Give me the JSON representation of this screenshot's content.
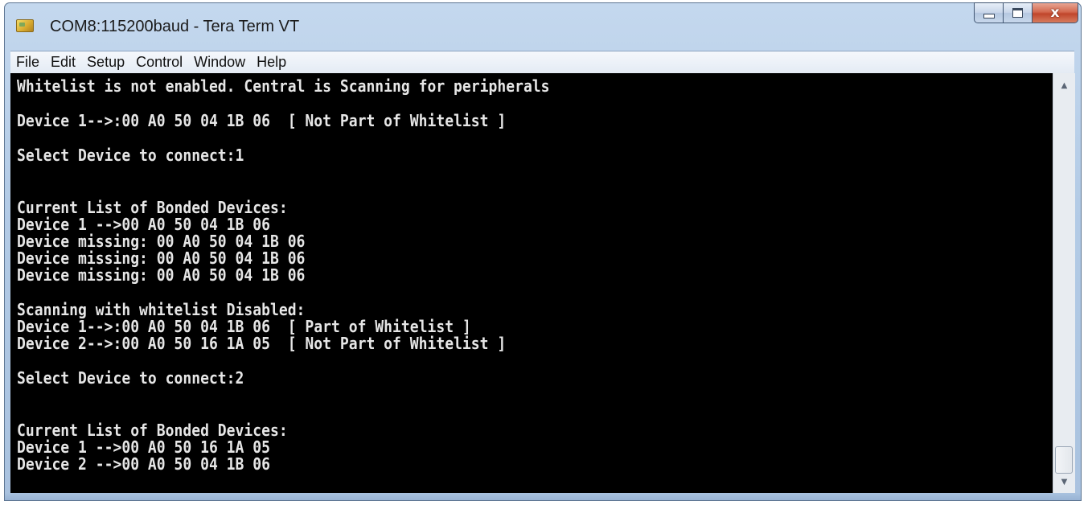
{
  "window": {
    "title": "COM8:115200baud - Tera Term VT",
    "minimize_glyph": "",
    "maximize_glyph": "",
    "close_glyph": "x"
  },
  "menu": [
    "File",
    "Edit",
    "Setup",
    "Control",
    "Window",
    "Help"
  ],
  "terminal": {
    "lines": [
      "Whitelist is not enabled. Central is Scanning for peripherals",
      "",
      "Device 1-->:00 A0 50 04 1B 06  [ Not Part of Whitelist ]",
      "",
      "Select Device to connect:1",
      "",
      "",
      "Current List of Bonded Devices:",
      "Device 1 -->00 A0 50 04 1B 06",
      "Device missing: 00 A0 50 04 1B 06",
      "Device missing: 00 A0 50 04 1B 06",
      "Device missing: 00 A0 50 04 1B 06",
      "",
      "Scanning with whitelist Disabled:",
      "Device 1-->:00 A0 50 04 1B 06  [ Part of Whitelist ]",
      "Device 2-->:00 A0 50 16 1A 05  [ Not Part of Whitelist ]",
      "",
      "Select Device to connect:2",
      "",
      "",
      "Current List of Bonded Devices:",
      "Device 1 -->00 A0 50 16 1A 05",
      "Device 2 -->00 A0 50 04 1B 06"
    ]
  },
  "scrollbar": {
    "position": 1.0,
    "up_icon": "scroll-up-arrow-icon",
    "down_icon": "scroll-down-arrow-icon"
  },
  "colors": {
    "terminal_bg": "#000000",
    "terminal_fg": "#e6e6e6",
    "close_button": "#c7462c",
    "frame": "#b3cbe6"
  }
}
